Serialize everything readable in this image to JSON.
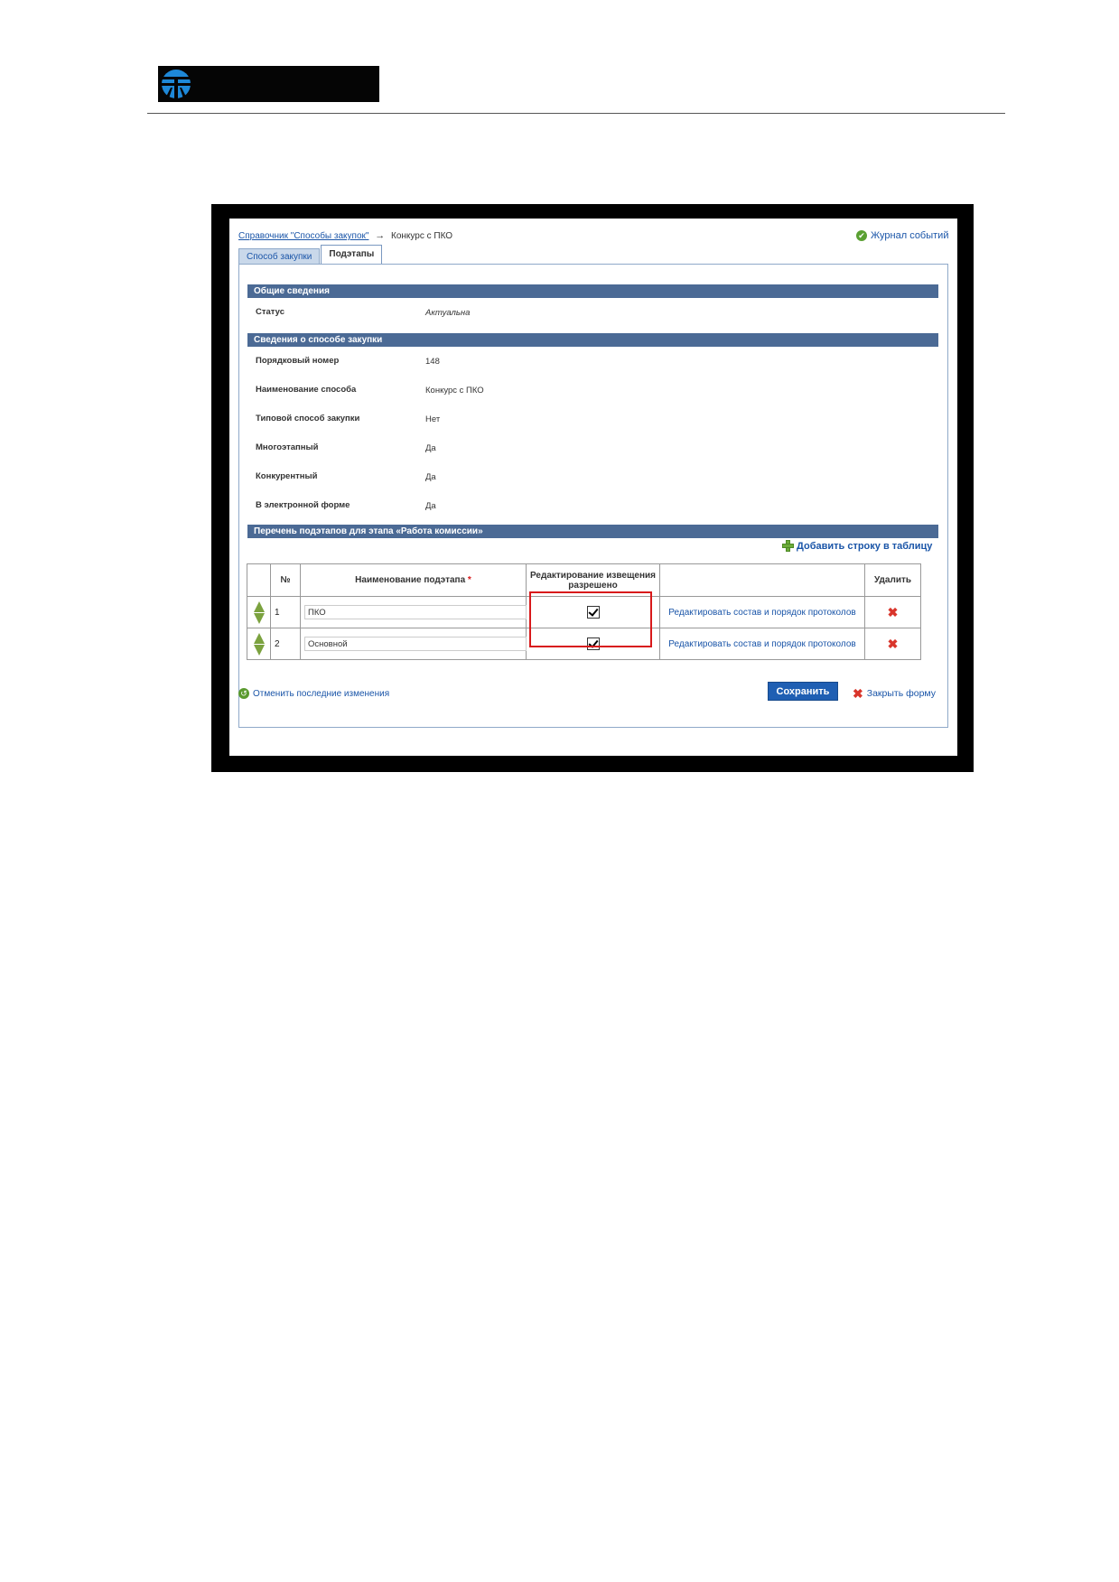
{
  "breadcrumb": {
    "link": "Справочник \"Способы закупок\"",
    "arrow": "→",
    "current": "Конкурс с ПКО"
  },
  "journal_link": "Журнал событий",
  "tabs": [
    {
      "label": "Способ закупки",
      "active": false
    },
    {
      "label": "Подэтапы",
      "active": true
    }
  ],
  "sections": {
    "general": "Общие сведения",
    "method_info": "Сведения о способе закупки",
    "substages": "Перечень подэтапов для этапа «Работа комиссии»"
  },
  "general_fields": {
    "status_label": "Статус",
    "status_value": "Актуальна"
  },
  "method_fields": [
    {
      "label": "Порядковый номер",
      "value": "148"
    },
    {
      "label": "Наименование способа",
      "value": "Конкурс с ПКО"
    },
    {
      "label": "Типовой способ закупки",
      "value": "Нет"
    },
    {
      "label": "Многоэтапный",
      "value": "Да"
    },
    {
      "label": "Конкурентный",
      "value": "Да"
    },
    {
      "label": "В электронной форме",
      "value": "Да"
    }
  ],
  "add_row_label": "Добавить строку в таблицу",
  "table": {
    "headers": {
      "num": "№",
      "name": "Наименование подэтапа",
      "required_mark": "*",
      "edit_allowed": "Редактирование извещения разрешено",
      "actions": "",
      "delete": "Удалить"
    },
    "rows": [
      {
        "num": "1",
        "name": "ПКО",
        "edit_allowed": true,
        "link": "Редактировать состав и порядок протоколов"
      },
      {
        "num": "2",
        "name": "Основной",
        "edit_allowed": true,
        "link": "Редактировать состав и порядок протоколов"
      }
    ]
  },
  "footer": {
    "undo": "Отменить последние изменения",
    "save": "Сохранить",
    "close": "Закрыть форму"
  },
  "colors": {
    "section_bar": "#4b6a95",
    "link": "#1a55a8",
    "save_button": "#1f5fb3",
    "highlight": "#d8191b"
  }
}
